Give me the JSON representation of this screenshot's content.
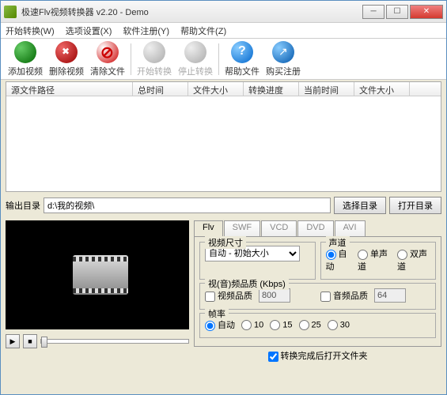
{
  "title": "极速Flv视频转换器 v2.20 - Demo",
  "menu": {
    "start": "开始转换(W)",
    "options": "选项设置(X)",
    "register": "软件注册(Y)",
    "help": "帮助文件(Z)"
  },
  "toolbar": {
    "add": "添加视频",
    "del": "删除视频",
    "clear": "清除文件",
    "start": "开始转换",
    "stop": "停止转换",
    "helpfile": "帮助文件",
    "buy": "购买注册"
  },
  "columns": {
    "c1": "源文件路径",
    "c2": "总时间",
    "c3": "文件大小",
    "c4": "转换进度",
    "c5": "当前时间",
    "c6": "文件大小"
  },
  "output": {
    "label": "输出目录",
    "path": "d:\\我的视频\\",
    "select": "选择目录",
    "open": "打开目录"
  },
  "tabs": {
    "flv": "Flv",
    "swf": "SWF",
    "vcd": "VCD",
    "dvd": "DVD",
    "avi": "AVI"
  },
  "video_size": {
    "label": "视频尺寸",
    "value": "自动 - 初始大小"
  },
  "audio_ch": {
    "label": "声道",
    "auto": "自动",
    "mono": "单声道",
    "stereo": "双声道"
  },
  "quality": {
    "label": "视(音)频品质 (Kbps)",
    "video_cb": "视频品质",
    "video_val": "800",
    "audio_cb": "音频品质",
    "audio_val": "64"
  },
  "fps": {
    "label": "帧率",
    "auto": "自动",
    "r10": "10",
    "r15": "15",
    "r25": "25",
    "r30": "30"
  },
  "openAfter": "转换完成后打开文件夹"
}
